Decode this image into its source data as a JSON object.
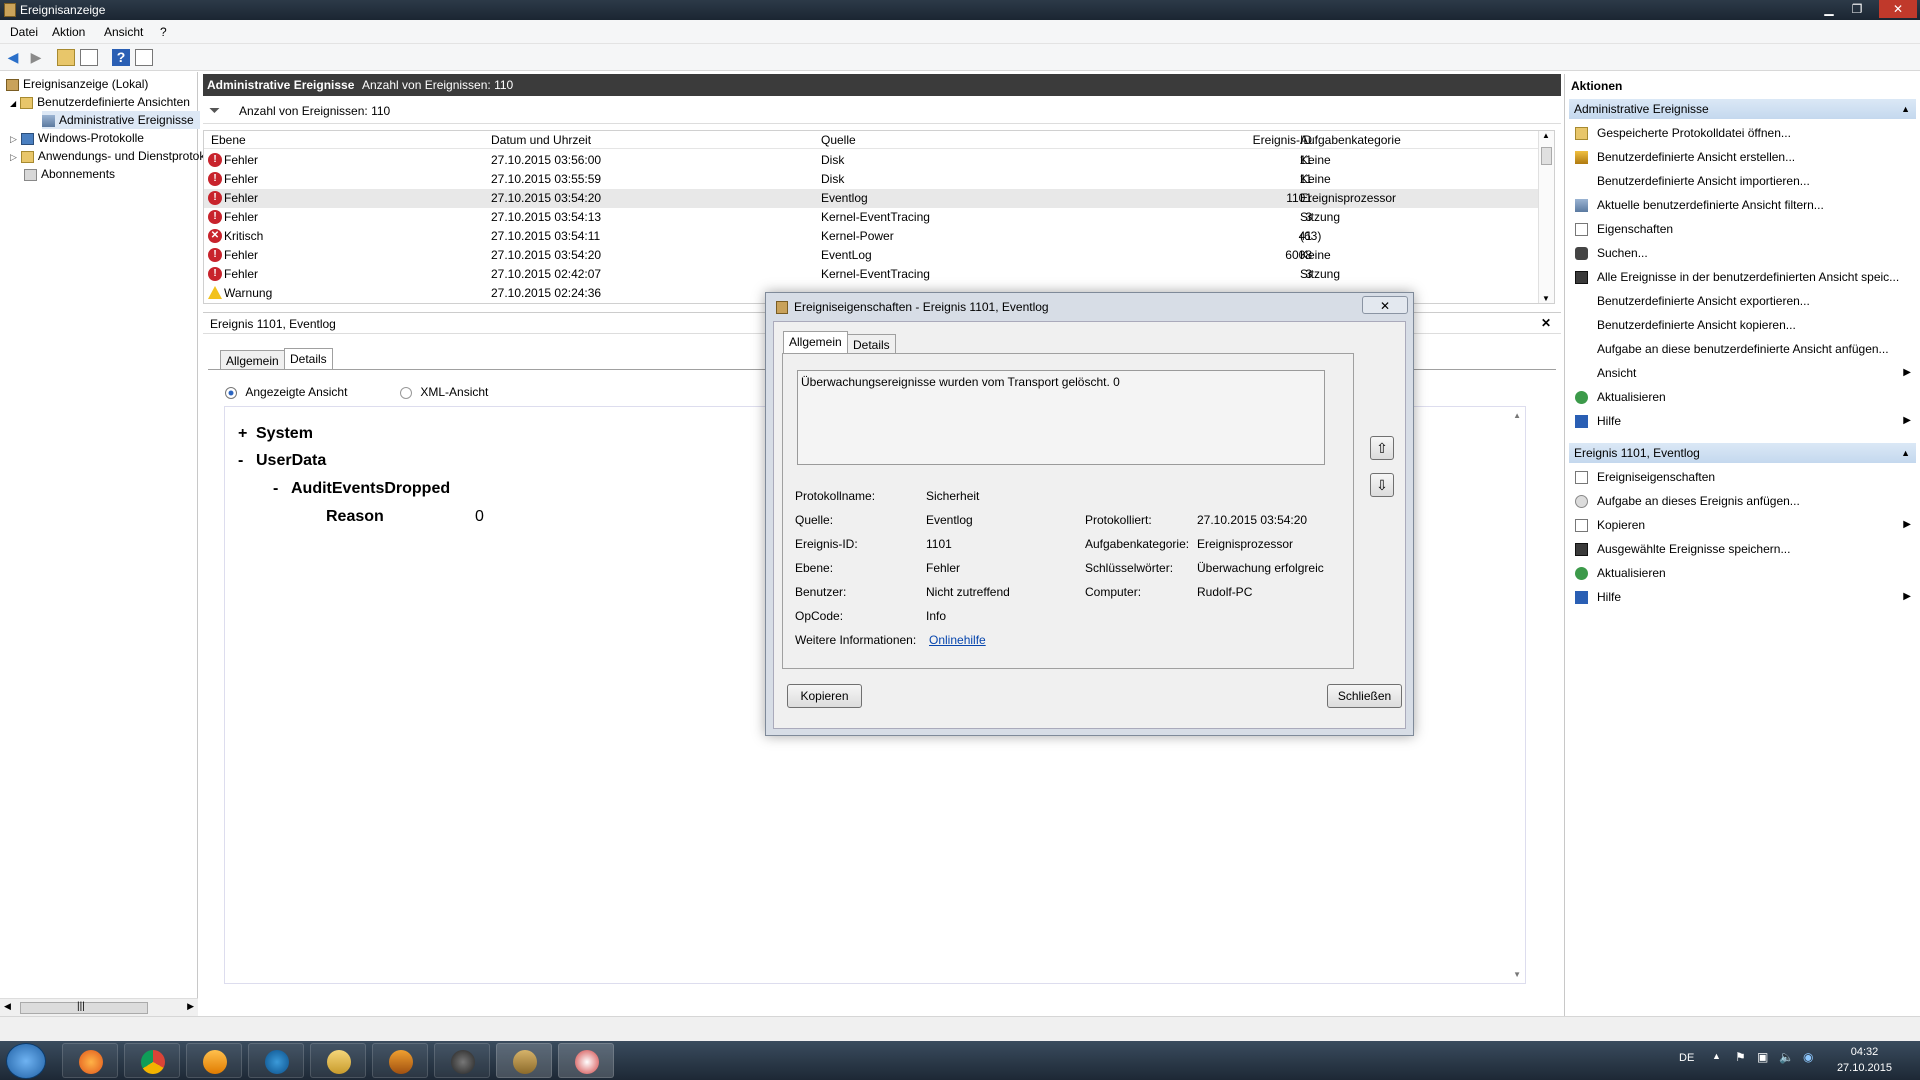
{
  "window": {
    "title": "Ereignisanzeige",
    "controls": {
      "minimize": "▁",
      "restore": "❐",
      "close": "✕"
    }
  },
  "menu": [
    "Datei",
    "Aktion",
    "Ansicht",
    "?"
  ],
  "toolbar_icons": [
    "back-arrow-icon",
    "forward-arrow-icon",
    "up-folder-icon",
    "show-hide-tree-icon",
    "help-icon",
    "action-pane-icon"
  ],
  "tree": {
    "root": "Ereignisanzeige (Lokal)",
    "custom_views": "Benutzerdefinierte Ansichten",
    "admin_events": "Administrative Ereignisse",
    "windows_logs": "Windows-Protokolle",
    "app_logs": "Anwendungs- und Dienstprotokolle",
    "subscriptions": "Abonnements",
    "scroll_grip": "|||"
  },
  "center": {
    "title": "Administrative Ereignisse",
    "count_label": "Anzahl von Ereignissen: 110",
    "filter_count": "Anzahl von Ereignissen: 110",
    "columns": [
      "Ebene",
      "Datum und Uhrzeit",
      "Quelle",
      "Ereignis-ID",
      "Aufgabenkategorie"
    ],
    "rows": [
      {
        "level": "Fehler",
        "type": "err",
        "date": "27.10.2015 03:56:00",
        "source": "Disk",
        "id": "11",
        "category": "Keine"
      },
      {
        "level": "Fehler",
        "type": "err",
        "date": "27.10.2015 03:55:59",
        "source": "Disk",
        "id": "11",
        "category": "Keine"
      },
      {
        "level": "Fehler",
        "type": "err",
        "date": "27.10.2015 03:54:20",
        "source": "Eventlog",
        "id": "1101",
        "category": "Ereignisprozessor"
      },
      {
        "level": "Fehler",
        "type": "err",
        "date": "27.10.2015 03:54:13",
        "source": "Kernel-EventTracing",
        "id": "3",
        "category": "Sitzung"
      },
      {
        "level": "Kritisch",
        "type": "crit",
        "date": "27.10.2015 03:54:11",
        "source": "Kernel-Power",
        "id": "41",
        "category": "(63)"
      },
      {
        "level": "Fehler",
        "type": "err",
        "date": "27.10.2015 03:54:20",
        "source": "EventLog",
        "id": "6008",
        "category": "Keine"
      },
      {
        "level": "Fehler",
        "type": "err",
        "date": "27.10.2015 02:42:07",
        "source": "Kernel-EventTracing",
        "id": "3",
        "category": "Sitzung"
      },
      {
        "level": "Warnung",
        "type": "warn",
        "date": "27.10.2015 02:24:36",
        "source": "",
        "id": "",
        "category": ""
      }
    ],
    "detail_title": "Ereignis 1101, Eventlog",
    "detail_close": "✕",
    "tabs": [
      "Allgemein",
      "Details"
    ],
    "view_options": [
      "Angezeigte Ansicht",
      "XML-Ansicht"
    ],
    "xml": {
      "system_toggle": "+",
      "system": "System",
      "userdata_toggle": "-",
      "userdata": "UserData",
      "audit_toggle": "-",
      "audit": "AuditEventsDropped",
      "reason_key": "Reason",
      "reason_val": "0"
    }
  },
  "actions": {
    "title": "Aktionen",
    "section1": "Administrative Ereignisse",
    "section1_items": [
      {
        "label": "Gespeicherte Protokolldatei öffnen...",
        "icon": "open-log-icon"
      },
      {
        "label": "Benutzerdefinierte Ansicht erstellen...",
        "icon": "filter-create-icon"
      },
      {
        "label": "Benutzerdefinierte Ansicht importieren...",
        "icon": ""
      },
      {
        "label": "Aktuelle benutzerdefinierte Ansicht filtern...",
        "icon": "filter-icon"
      },
      {
        "label": "Eigenschaften",
        "icon": "properties-icon"
      },
      {
        "label": "Suchen...",
        "icon": "binoculars-icon"
      },
      {
        "label": "Alle Ereignisse in der benutzerdefinierten Ansicht speic...",
        "icon": "save-icon"
      },
      {
        "label": "Benutzerdefinierte Ansicht exportieren...",
        "icon": ""
      },
      {
        "label": "Benutzerdefinierte Ansicht kopieren...",
        "icon": ""
      },
      {
        "label": "Aufgabe an diese benutzerdefinierte Ansicht anfügen...",
        "icon": ""
      },
      {
        "label": "Ansicht",
        "icon": "",
        "submenu": true
      },
      {
        "label": "Aktualisieren",
        "icon": "refresh-icon"
      },
      {
        "label": "Hilfe",
        "icon": "help-icon",
        "submenu": true
      }
    ],
    "section2": "Ereignis 1101, Eventlog",
    "section2_items": [
      {
        "label": "Ereigniseigenschaften",
        "icon": "properties-icon"
      },
      {
        "label": "Aufgabe an dieses Ereignis anfügen...",
        "icon": "task-icon"
      },
      {
        "label": "Kopieren",
        "icon": "copy-icon",
        "submenu": true
      },
      {
        "label": "Ausgewählte Ereignisse speichern...",
        "icon": "save-icon"
      },
      {
        "label": "Aktualisieren",
        "icon": "refresh-icon"
      },
      {
        "label": "Hilfe",
        "icon": "help-icon",
        "submenu": true
      }
    ],
    "collapse_glyph": "▲",
    "submenu_glyph": "▶"
  },
  "dialog": {
    "title": "Ereigniseigenschaften - Ereignis 1101, Eventlog",
    "close": "✕",
    "tabs": [
      "Allgemein",
      "Details"
    ],
    "message": "Überwachungsereignisse wurden vom Transport gelöscht. 0",
    "fields": {
      "log_name_label": "Protokollname:",
      "log_name": "Sicherheit",
      "source_label": "Quelle:",
      "source": "Eventlog",
      "logged_label": "Protokolliert:",
      "logged": "27.10.2015 03:54:20",
      "event_id_label": "Ereignis-ID:",
      "event_id": "1101",
      "task_label": "Aufgabenkategorie:",
      "task": "Ereignisprozessor",
      "level_label": "Ebene:",
      "level": "Fehler",
      "keywords_label": "Schlüsselwörter:",
      "keywords": "Überwachung erfolgreic",
      "user_label": "Benutzer:",
      "user": "Nicht zutreffend",
      "computer_label": "Computer:",
      "computer": "Rudolf-PC",
      "opcode_label": "OpCode:",
      "opcode": "Info",
      "more_info_label": "Weitere Informationen:",
      "more_info_link": "Onlinehilfe"
    },
    "copy_button": "Kopieren",
    "close_button": "Schließen",
    "prev_glyph": "⇧",
    "next_glyph": "⇩"
  },
  "taskbar": {
    "apps": [
      "firefox",
      "chrome",
      "media-player",
      "ccleaner",
      "explorer",
      "winamp",
      "audio",
      "event-viewer",
      "tools"
    ],
    "language": "DE",
    "time": "04:32",
    "date": "27.10.2015"
  }
}
